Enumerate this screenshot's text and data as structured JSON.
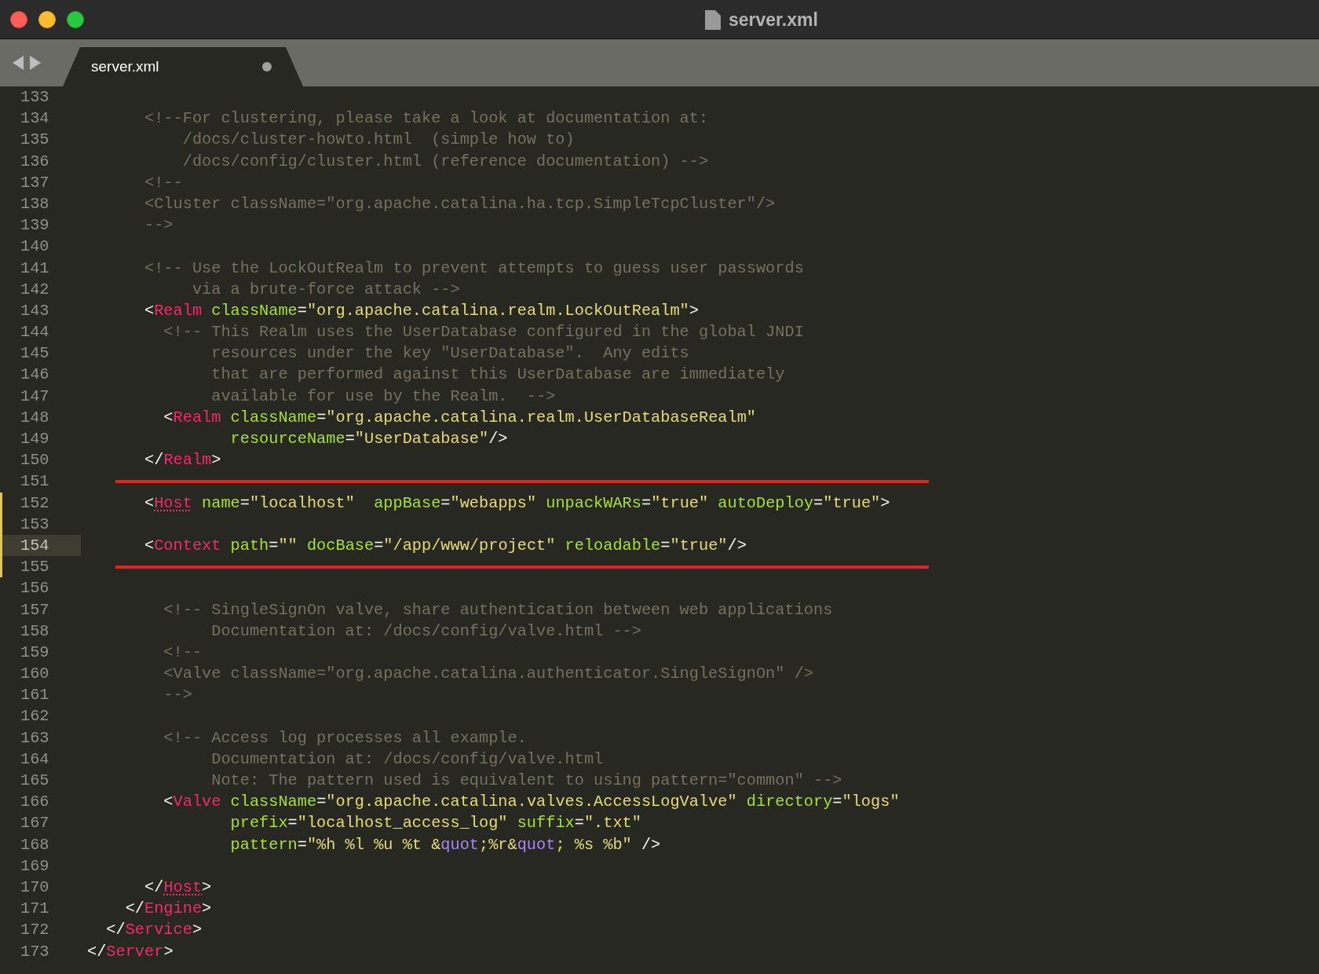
{
  "window": {
    "title": "server.xml"
  },
  "tabs": [
    {
      "label": "server.xml",
      "selected": true,
      "unsaved": true
    }
  ],
  "editor": {
    "lines": [
      {
        "number": "133",
        "current": false,
        "modified": false,
        "marked": false
      },
      {
        "number": "134",
        "current": false,
        "modified": false,
        "marked": false,
        "tokens": [
          {
            "kind": "comment",
            "text": "      <!--For clustering, please take a look at documentation at:"
          }
        ]
      },
      {
        "number": "135",
        "current": false,
        "modified": false,
        "marked": false,
        "tokens": [
          {
            "kind": "comment",
            "text": "          /docs/cluster-howto.html  (simple how to)"
          }
        ]
      },
      {
        "number": "136",
        "current": false,
        "modified": false,
        "marked": false,
        "tokens": [
          {
            "kind": "comment",
            "text": "          /docs/config/cluster.html (reference documentation) -->"
          }
        ]
      },
      {
        "number": "137",
        "current": false,
        "modified": false,
        "marked": false,
        "tokens": [
          {
            "kind": "comment",
            "text": "      <!--"
          }
        ]
      },
      {
        "number": "138",
        "current": false,
        "modified": false,
        "marked": false,
        "tokens": [
          {
            "kind": "comment",
            "text": "      <Cluster className=\"org.apache.catalina.ha.tcp.SimpleTcpCluster\"/>"
          }
        ]
      },
      {
        "number": "139",
        "current": false,
        "modified": false,
        "marked": false,
        "tokens": [
          {
            "kind": "comment",
            "text": "      -->"
          }
        ]
      },
      {
        "number": "140",
        "current": false,
        "modified": false,
        "marked": false
      },
      {
        "number": "141",
        "current": false,
        "modified": false,
        "marked": false,
        "tokens": [
          {
            "kind": "comment",
            "text": "      <!-- Use the LockOutRealm to prevent attempts to guess user passwords"
          }
        ]
      },
      {
        "number": "142",
        "current": false,
        "modified": false,
        "marked": false,
        "tokens": [
          {
            "kind": "comment",
            "text": "           via a brute-force attack -->"
          }
        ]
      },
      {
        "number": "143",
        "current": false,
        "modified": false,
        "marked": false,
        "tokens": [
          {
            "kind": "punct",
            "text": "      <"
          },
          {
            "kind": "tag",
            "text": "Realm"
          },
          {
            "kind": "attr",
            "text": " className"
          },
          {
            "kind": "punct",
            "text": "="
          },
          {
            "kind": "string",
            "text": "\"org.apache.catalina.realm.LockOutRealm\""
          },
          {
            "kind": "punct",
            "text": ">"
          }
        ]
      },
      {
        "number": "144",
        "current": false,
        "modified": false,
        "marked": false,
        "tokens": [
          {
            "kind": "comment",
            "text": "        <!-- This Realm uses the UserDatabase configured in the global JNDI"
          }
        ]
      },
      {
        "number": "145",
        "current": false,
        "modified": false,
        "marked": false,
        "tokens": [
          {
            "kind": "comment",
            "text": "             resources under the key \"UserDatabase\".  Any edits"
          }
        ]
      },
      {
        "number": "146",
        "current": false,
        "modified": false,
        "marked": false,
        "tokens": [
          {
            "kind": "comment",
            "text": "             that are performed against this UserDatabase are immediately"
          }
        ]
      },
      {
        "number": "147",
        "current": false,
        "modified": false,
        "marked": false,
        "tokens": [
          {
            "kind": "comment",
            "text": "             available for use by the Realm.  -->"
          }
        ]
      },
      {
        "number": "148",
        "current": false,
        "modified": false,
        "marked": false,
        "tokens": [
          {
            "kind": "punct",
            "text": "        <"
          },
          {
            "kind": "tag",
            "text": "Realm"
          },
          {
            "kind": "attr",
            "text": " className"
          },
          {
            "kind": "punct",
            "text": "="
          },
          {
            "kind": "string",
            "text": "\"org.apache.catalina.realm.UserDatabaseRealm\""
          }
        ]
      },
      {
        "number": "149",
        "current": false,
        "modified": false,
        "marked": false,
        "tokens": [
          {
            "kind": "attr",
            "text": "               resourceName"
          },
          {
            "kind": "punct",
            "text": "="
          },
          {
            "kind": "string",
            "text": "\"UserDatabase\""
          },
          {
            "kind": "punct",
            "text": "/>"
          }
        ]
      },
      {
        "number": "150",
        "current": false,
        "modified": false,
        "marked": false,
        "tokens": [
          {
            "kind": "punct",
            "text": "      </"
          },
          {
            "kind": "tag",
            "text": "Realm"
          },
          {
            "kind": "punct",
            "text": ">"
          }
        ]
      },
      {
        "number": "151",
        "current": false,
        "modified": false,
        "marked": true
      },
      {
        "number": "152",
        "current": false,
        "modified": true,
        "marked": false,
        "tokens": [
          {
            "kind": "punct",
            "text": "      <"
          },
          {
            "kind": "tag",
            "text": "Host",
            "underlined": true
          },
          {
            "kind": "attr",
            "text": " name"
          },
          {
            "kind": "punct",
            "text": "="
          },
          {
            "kind": "string",
            "text": "\"localhost\""
          },
          {
            "kind": "attr",
            "text": "  appBase"
          },
          {
            "kind": "punct",
            "text": "="
          },
          {
            "kind": "string",
            "text": "\"webapps\""
          },
          {
            "kind": "attr",
            "text": " unpackWARs"
          },
          {
            "kind": "punct",
            "text": "="
          },
          {
            "kind": "string",
            "text": "\"true\""
          },
          {
            "kind": "attr",
            "text": " autoDeploy"
          },
          {
            "kind": "punct",
            "text": "="
          },
          {
            "kind": "string",
            "text": "\"true\""
          },
          {
            "kind": "punct",
            "text": ">"
          }
        ]
      },
      {
        "number": "153",
        "current": false,
        "modified": true,
        "marked": false
      },
      {
        "number": "154",
        "current": true,
        "modified": true,
        "marked": false,
        "tokens": [
          {
            "kind": "punct",
            "text": "      <"
          },
          {
            "kind": "tag",
            "text": "Context"
          },
          {
            "kind": "attr",
            "text": " path"
          },
          {
            "kind": "punct",
            "text": "="
          },
          {
            "kind": "string",
            "text": "\"\""
          },
          {
            "kind": "attr",
            "text": " docBase"
          },
          {
            "kind": "punct",
            "text": "="
          },
          {
            "kind": "string",
            "text": "\"/app/www/project\""
          },
          {
            "kind": "attr",
            "text": " reloadable"
          },
          {
            "kind": "punct",
            "text": "="
          },
          {
            "kind": "string",
            "text": "\"true\""
          },
          {
            "kind": "punct",
            "text": "/>"
          }
        ]
      },
      {
        "number": "155",
        "current": false,
        "modified": true,
        "marked": true
      },
      {
        "number": "156",
        "current": false,
        "modified": false,
        "marked": false
      },
      {
        "number": "157",
        "current": false,
        "modified": false,
        "marked": false,
        "tokens": [
          {
            "kind": "comment",
            "text": "        <!-- SingleSignOn valve, share authentication between web applications"
          }
        ]
      },
      {
        "number": "158",
        "current": false,
        "modified": false,
        "marked": false,
        "tokens": [
          {
            "kind": "comment",
            "text": "             Documentation at: /docs/config/valve.html -->"
          }
        ]
      },
      {
        "number": "159",
        "current": false,
        "modified": false,
        "marked": false,
        "tokens": [
          {
            "kind": "comment",
            "text": "        <!--"
          }
        ]
      },
      {
        "number": "160",
        "current": false,
        "modified": false,
        "marked": false,
        "tokens": [
          {
            "kind": "comment",
            "text": "        <Valve className=\"org.apache.catalina.authenticator.SingleSignOn\" />"
          }
        ]
      },
      {
        "number": "161",
        "current": false,
        "modified": false,
        "marked": false,
        "tokens": [
          {
            "kind": "comment",
            "text": "        -->"
          }
        ]
      },
      {
        "number": "162",
        "current": false,
        "modified": false,
        "marked": false
      },
      {
        "number": "163",
        "current": false,
        "modified": false,
        "marked": false,
        "tokens": [
          {
            "kind": "comment",
            "text": "        <!-- Access log processes all example."
          }
        ]
      },
      {
        "number": "164",
        "current": false,
        "modified": false,
        "marked": false,
        "tokens": [
          {
            "kind": "comment",
            "text": "             Documentation at: /docs/config/valve.html"
          }
        ]
      },
      {
        "number": "165",
        "current": false,
        "modified": false,
        "marked": false,
        "tokens": [
          {
            "kind": "comment",
            "text": "             Note: The pattern used is equivalent to using pattern=\"common\" -->"
          }
        ]
      },
      {
        "number": "166",
        "current": false,
        "modified": false,
        "marked": false,
        "tokens": [
          {
            "kind": "punct",
            "text": "        <"
          },
          {
            "kind": "tag",
            "text": "Valve"
          },
          {
            "kind": "attr",
            "text": " className"
          },
          {
            "kind": "punct",
            "text": "="
          },
          {
            "kind": "string",
            "text": "\"org.apache.catalina.valves.AccessLogValve\""
          },
          {
            "kind": "attr",
            "text": " directory"
          },
          {
            "kind": "punct",
            "text": "="
          },
          {
            "kind": "string",
            "text": "\"logs\""
          }
        ]
      },
      {
        "number": "167",
        "current": false,
        "modified": false,
        "marked": false,
        "tokens": [
          {
            "kind": "attr",
            "text": "               prefix"
          },
          {
            "kind": "punct",
            "text": "="
          },
          {
            "kind": "string",
            "text": "\"localhost_access_log\""
          },
          {
            "kind": "attr",
            "text": " suffix"
          },
          {
            "kind": "punct",
            "text": "="
          },
          {
            "kind": "string",
            "text": "\".txt\""
          }
        ]
      },
      {
        "number": "168",
        "current": false,
        "modified": false,
        "marked": false,
        "tokens": [
          {
            "kind": "attr",
            "text": "               pattern"
          },
          {
            "kind": "punct",
            "text": "="
          },
          {
            "kind": "string",
            "text": "\"%h %l %u %t &"
          },
          {
            "kind": "entity",
            "text": "quot"
          },
          {
            "kind": "string",
            "text": ";%r&"
          },
          {
            "kind": "entity",
            "text": "quot"
          },
          {
            "kind": "string",
            "text": "; %s %b\""
          },
          {
            "kind": "punct",
            "text": " />"
          }
        ]
      },
      {
        "number": "169",
        "current": false,
        "modified": false,
        "marked": false
      },
      {
        "number": "170",
        "current": false,
        "modified": false,
        "marked": false,
        "tokens": [
          {
            "kind": "punct",
            "text": "      </"
          },
          {
            "kind": "tag",
            "text": "Host",
            "underlined": true
          },
          {
            "kind": "punct",
            "text": ">"
          }
        ]
      },
      {
        "number": "171",
        "current": false,
        "modified": false,
        "marked": false,
        "tokens": [
          {
            "kind": "punct",
            "text": "    </"
          },
          {
            "kind": "tag",
            "text": "Engine"
          },
          {
            "kind": "punct",
            "text": ">"
          }
        ]
      },
      {
        "number": "172",
        "current": false,
        "modified": false,
        "marked": false,
        "tokens": [
          {
            "kind": "punct",
            "text": "  </"
          },
          {
            "kind": "tag",
            "text": "Service"
          },
          {
            "kind": "punct",
            "text": ">"
          }
        ]
      },
      {
        "number": "173",
        "current": false,
        "modified": false,
        "marked": false,
        "tokens": [
          {
            "kind": "punct",
            "text": "</"
          },
          {
            "kind": "tag",
            "text": "Server"
          },
          {
            "kind": "punct",
            "text": ">"
          }
        ]
      }
    ]
  }
}
